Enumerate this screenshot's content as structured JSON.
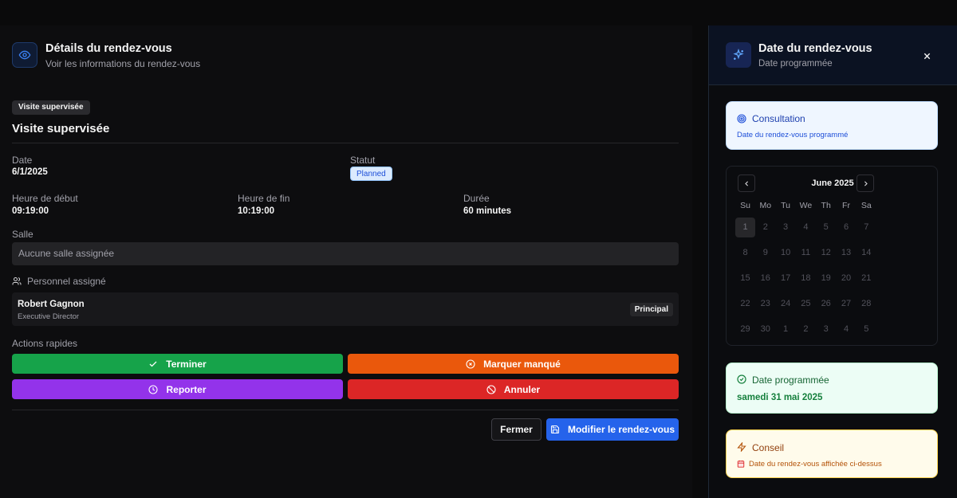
{
  "details": {
    "title": "Détails du rendez-vous",
    "subtitle": "Voir les informations du rendez-vous",
    "type_chip": "Visite supervisée",
    "type_title": "Visite supervisée",
    "date_label": "Date",
    "date_value": "6/1/2025",
    "status_label": "Statut",
    "status_value": "Planned",
    "start_label": "Heure de début",
    "start_value": "09:19:00",
    "end_label": "Heure de fin",
    "end_value": "10:19:00",
    "duration_label": "Durée",
    "duration_value": "60 minutes",
    "room_label": "Salle",
    "room_value": "Aucune salle assignée",
    "staff_label": "Personnel assigné",
    "staff": {
      "name": "Robert Gagnon",
      "role": "Executive Director",
      "badge": "Principal"
    },
    "actions_label": "Actions rapides",
    "actions": {
      "complete": "Terminer",
      "missed": "Marquer manqué",
      "reschedule": "Reporter",
      "cancel": "Annuler"
    },
    "close_button": "Fermer",
    "edit_button": "Modifier le rendez-vous"
  },
  "side": {
    "title": "Date du rendez-vous",
    "subtitle": "Date programmée",
    "consultation_title": "Consultation",
    "consultation_text": "Date du rendez-vous programmé",
    "calendar": {
      "month": "June 2025",
      "weekdays": [
        "Su",
        "Mo",
        "Tu",
        "We",
        "Th",
        "Fr",
        "Sa"
      ],
      "days": [
        "1",
        "2",
        "3",
        "4",
        "5",
        "6",
        "7",
        "8",
        "9",
        "10",
        "11",
        "12",
        "13",
        "14",
        "15",
        "16",
        "17",
        "18",
        "19",
        "20",
        "21",
        "22",
        "23",
        "24",
        "25",
        "26",
        "27",
        "28",
        "29",
        "30",
        "1",
        "2",
        "3",
        "4",
        "5"
      ],
      "selected": "1"
    },
    "scheduled_title": "Date programmée",
    "scheduled_value": "samedi 31 mai 2025",
    "tip_title": "Conseil",
    "tip_text": "Date du rendez-vous affichée ci-dessus"
  },
  "colors": {
    "complete": "#16a34a",
    "missed": "#ea580c",
    "reschedule": "#9333ea",
    "cancel": "#dc2626",
    "primary": "#2563eb"
  }
}
